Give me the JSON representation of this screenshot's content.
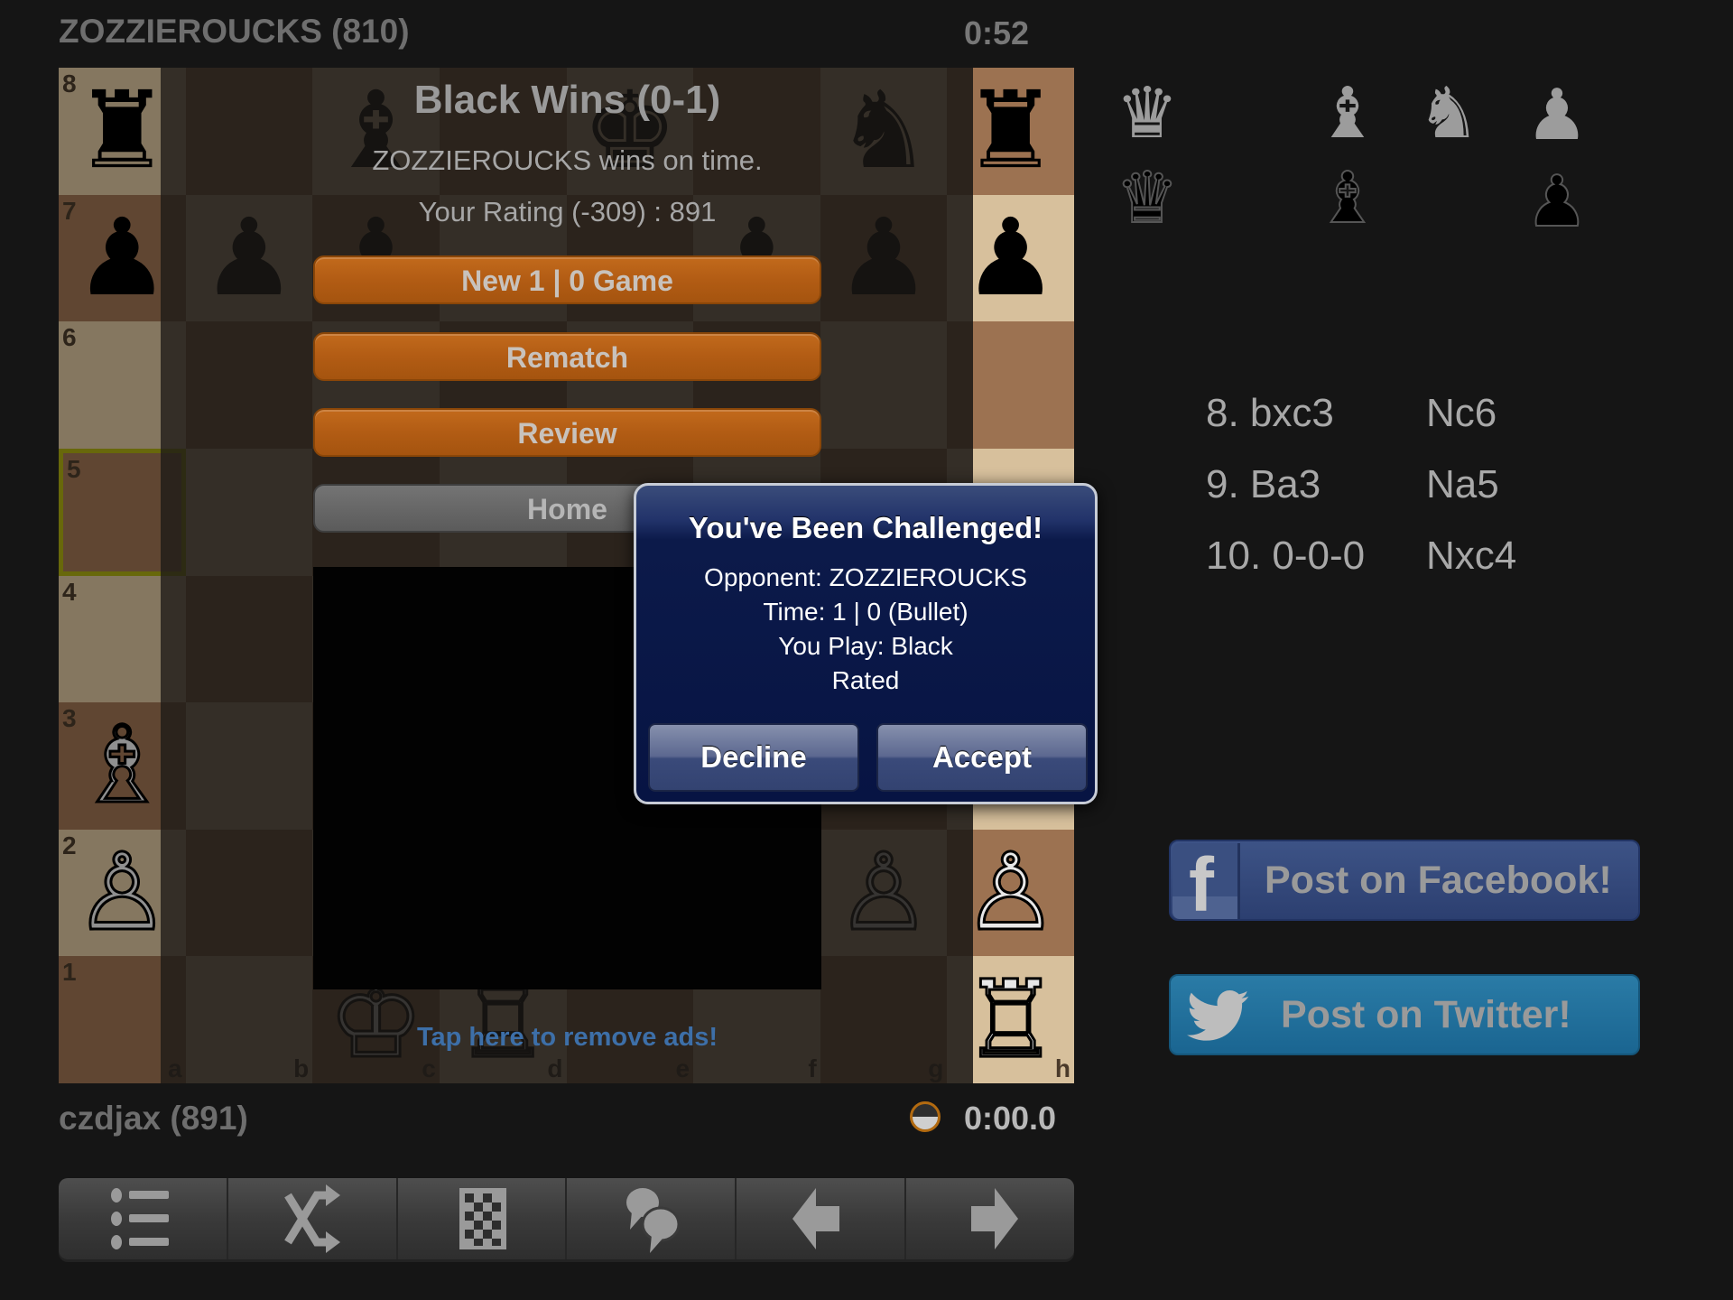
{
  "top_player": {
    "name": "ZOZZIEROUCKS",
    "rating": "(810)",
    "label": "ZOZZIEROUCKS (810)",
    "clock": "0:52"
  },
  "bottom_player": {
    "name": "czdjax",
    "rating": "(891)",
    "label": "czdjax (891)",
    "clock": "0:00.0",
    "turn_indicator": "active"
  },
  "board": {
    "ranks": [
      "8",
      "7",
      "6",
      "5",
      "4",
      "3",
      "2",
      "1"
    ],
    "files": [
      "a",
      "b",
      "c",
      "d",
      "e",
      "f",
      "g",
      "h"
    ],
    "highlight_square": "a5",
    "pieces": [
      {
        "square": "a8",
        "piece": "rook",
        "color": "black",
        "glyph": "♜"
      },
      {
        "square": "a7",
        "piece": "pawn",
        "color": "black",
        "glyph": "♟"
      },
      {
        "square": "a3",
        "piece": "bishop",
        "color": "white",
        "glyph": "♗"
      },
      {
        "square": "a2",
        "piece": "pawn",
        "color": "white",
        "glyph": "♙"
      },
      {
        "square": "h8",
        "piece": "rook",
        "color": "black",
        "glyph": "♜"
      },
      {
        "square": "h7",
        "piece": "pawn",
        "color": "black",
        "glyph": "♟"
      },
      {
        "square": "h2",
        "piece": "pawn",
        "color": "white",
        "glyph": "♙"
      },
      {
        "square": "h1",
        "piece": "rook",
        "color": "white",
        "glyph": "♖"
      },
      {
        "square": "c8",
        "piece": "bishop",
        "color": "black",
        "glyph": "♝"
      },
      {
        "square": "e8",
        "piece": "king",
        "color": "black",
        "glyph": "♚"
      },
      {
        "square": "g8",
        "piece": "knight",
        "color": "black",
        "glyph": "♞"
      },
      {
        "square": "b7",
        "piece": "pawn",
        "color": "black",
        "glyph": "♟"
      },
      {
        "square": "c7",
        "piece": "pawn",
        "color": "black",
        "glyph": "♟"
      },
      {
        "square": "f7",
        "piece": "pawn",
        "color": "black",
        "glyph": "♟"
      },
      {
        "square": "g7",
        "piece": "pawn",
        "color": "black",
        "glyph": "♟"
      },
      {
        "square": "g2",
        "piece": "pawn",
        "color": "white",
        "glyph": "♙"
      },
      {
        "square": "c1",
        "piece": "king",
        "color": "white",
        "glyph": "♔"
      },
      {
        "square": "d1",
        "piece": "rook",
        "color": "white",
        "glyph": "♖"
      }
    ]
  },
  "result": {
    "title": "Black Wins (0-1)",
    "reason": "ZOZZIEROUCKS wins on time.",
    "rating": "Your Rating (-309) : 891",
    "buttons": {
      "new_game": "New 1 | 0 Game",
      "rematch": "Rematch",
      "review": "Review",
      "home": "Home"
    }
  },
  "ad": {
    "remove_ads": "Tap here to remove ads!"
  },
  "challenge_dialog": {
    "title": "You've Been Challenged!",
    "opponent": "Opponent: ZOZZIEROUCKS",
    "time": "Time: 1 | 0 (Bullet)",
    "you_play": "You Play: Black",
    "rated": "Rated",
    "decline": "Decline",
    "accept": "Accept"
  },
  "captured": {
    "white": [
      {
        "piece": "queen",
        "glyph": "♛"
      },
      {
        "piece": "bishop",
        "glyph": "♝"
      },
      {
        "piece": "knight",
        "glyph": "♞"
      },
      {
        "piece": "pawn",
        "glyph": "♟"
      }
    ],
    "black": [
      {
        "piece": "queen",
        "glyph": "♛"
      },
      {
        "piece": "bishop",
        "glyph": "♝"
      },
      {
        "piece": "pawn",
        "glyph": "♟"
      }
    ]
  },
  "moves": [
    {
      "num": "8.",
      "white": "8. bxc3",
      "black": "Nc6"
    },
    {
      "num": "9.",
      "white": "9. Ba3",
      "black": "Na5"
    },
    {
      "num": "10.",
      "white": "10. 0-0-0",
      "black": "Nxc4"
    }
  ],
  "social": {
    "facebook": "Post on Facebook!",
    "twitter": "Post on Twitter!",
    "facebook_icon": "f"
  },
  "toolbar": {
    "items": [
      {
        "name": "menu-list-icon"
      },
      {
        "name": "shuffle-icon"
      },
      {
        "name": "board-icon"
      },
      {
        "name": "chat-icon"
      },
      {
        "name": "back-arrow-icon"
      },
      {
        "name": "forward-arrow-icon"
      }
    ]
  },
  "colors": {
    "accent_orange": "#b25c14",
    "dialog_navy": "#071443",
    "facebook": "#2c3f70",
    "twitter": "#1a6591",
    "link_blue": "#3d6fa8",
    "highlight": "#a8a812"
  }
}
